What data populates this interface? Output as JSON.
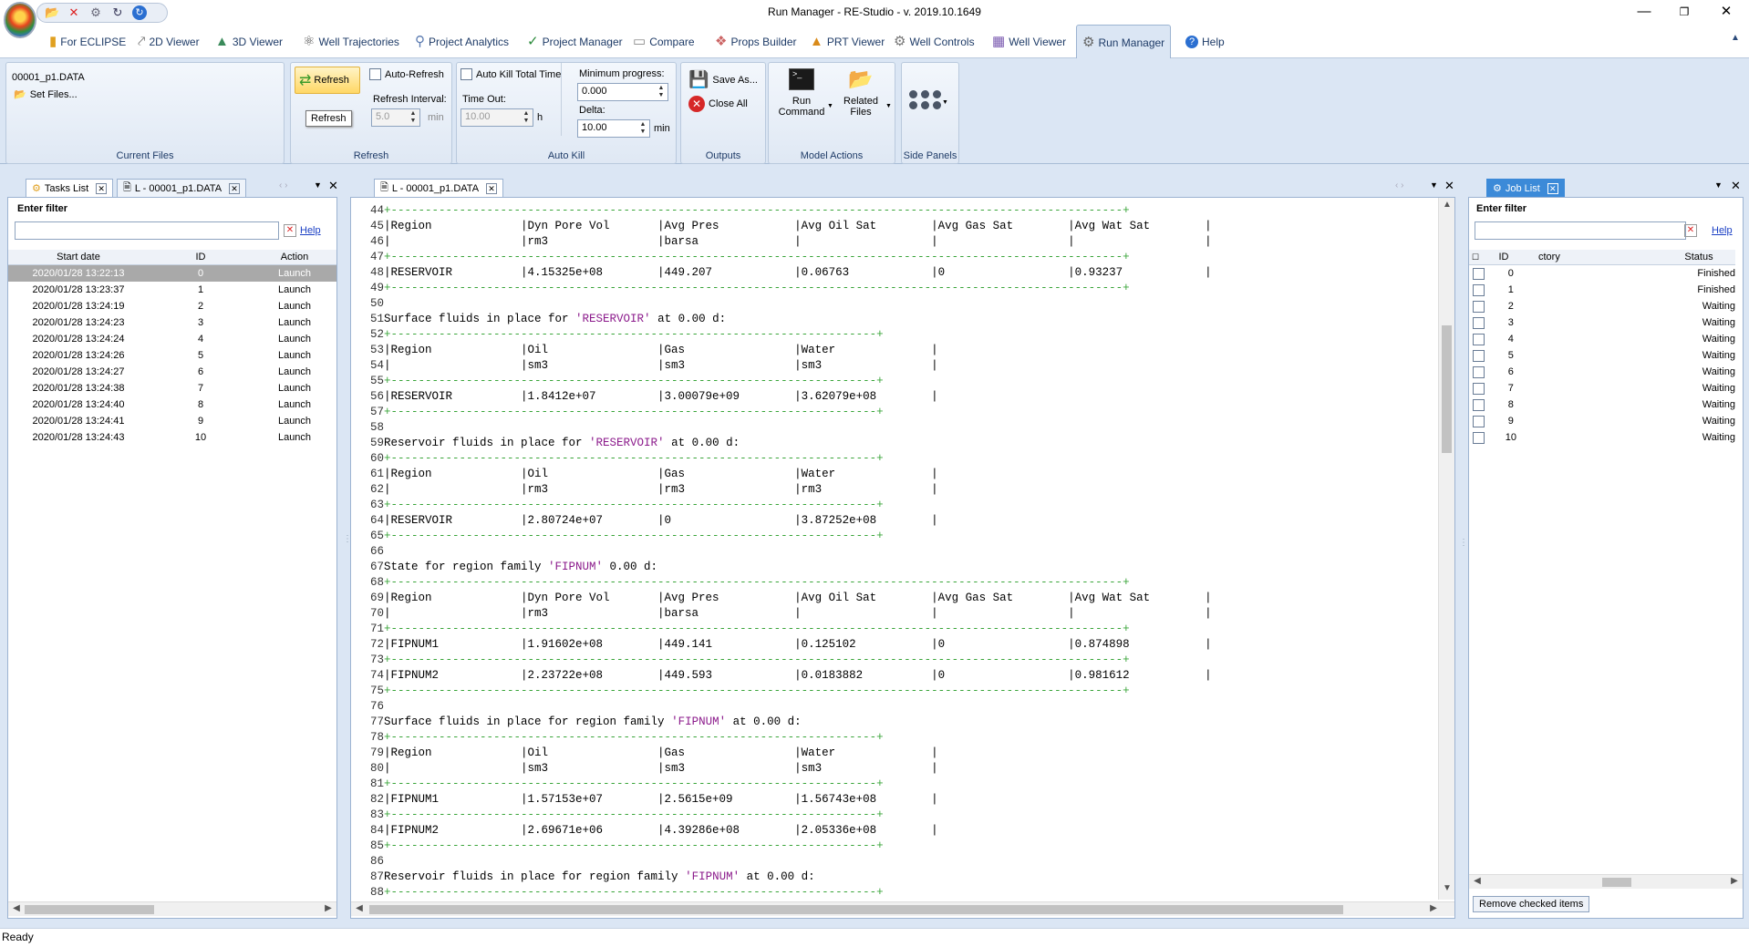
{
  "window": {
    "title": "Run Manager - RE-Studio - v. 2019.10.1649"
  },
  "ribbon_tabs": [
    {
      "label": "For ECLIPSE",
      "icon": "eclipse-icon"
    },
    {
      "label": "2D Viewer",
      "icon": "2d-viewer-icon"
    },
    {
      "label": "3D Viewer",
      "icon": "3d-viewer-icon"
    },
    {
      "label": "Well Trajectories",
      "icon": "well-trajectory-icon"
    },
    {
      "label": "Project Analytics",
      "icon": "analytics-icon"
    },
    {
      "label": "Project Manager",
      "icon": "project-manager-icon"
    },
    {
      "label": "Compare",
      "icon": "compare-icon"
    },
    {
      "label": "Props Builder",
      "icon": "props-builder-icon"
    },
    {
      "label": "PRT Viewer",
      "icon": "prt-viewer-icon"
    },
    {
      "label": "Well Controls",
      "icon": "well-controls-icon"
    },
    {
      "label": "Well Viewer",
      "icon": "well-viewer-icon"
    },
    {
      "label": "Run Manager",
      "icon": "run-manager-icon",
      "active": true
    },
    {
      "label": "Help",
      "icon": "help-icon"
    }
  ],
  "current_files": {
    "file": "00001_p1.DATA",
    "set_files": "Set Files...",
    "group_label": "Current Files"
  },
  "refresh": {
    "button": "Refresh",
    "tooltip": "Refresh",
    "auto_refresh": "Auto-Refresh",
    "interval_label": "Refresh Interval:",
    "interval_value": "5.0",
    "interval_unit": "min",
    "group_label": "Refresh"
  },
  "auto_kill": {
    "total_time": "Auto Kill Total Time",
    "timeout_label": "Time Out:",
    "timeout_value": "10.00",
    "timeout_unit": "h",
    "min_progress_label": "Minimum progress:",
    "min_progress_value": "0.000",
    "delta_label": "Delta:",
    "delta_value": "10.00",
    "delta_unit": "min",
    "group_label": "Auto Kill"
  },
  "outputs": {
    "save_as": "Save As...",
    "close_all": "Close All",
    "group_label": "Outputs"
  },
  "model_actions": {
    "run_command_1": "Run",
    "run_command_2": "Command",
    "related_files_1": "Related",
    "related_files_2": "Files",
    "group_label": "Model Actions"
  },
  "side_panels": {
    "group_label": "Side Panels"
  },
  "left_panel": {
    "tabs": [
      "Tasks List",
      "L - 00001_p1.DATA"
    ],
    "filter_label": "Enter filter",
    "help": "Help",
    "columns": [
      "Start date",
      "ID",
      "Action"
    ],
    "rows": [
      [
        "2020/01/28 13:22:13",
        "0",
        "Launch"
      ],
      [
        "2020/01/28 13:23:37",
        "1",
        "Launch"
      ],
      [
        "2020/01/28 13:24:19",
        "2",
        "Launch"
      ],
      [
        "2020/01/28 13:24:23",
        "3",
        "Launch"
      ],
      [
        "2020/01/28 13:24:24",
        "4",
        "Launch"
      ],
      [
        "2020/01/28 13:24:26",
        "5",
        "Launch"
      ],
      [
        "2020/01/28 13:24:27",
        "6",
        "Launch"
      ],
      [
        "2020/01/28 13:24:38",
        "7",
        "Launch"
      ],
      [
        "2020/01/28 13:24:40",
        "8",
        "Launch"
      ],
      [
        "2020/01/28 13:24:41",
        "9",
        "Launch"
      ],
      [
        "2020/01/28 13:24:43",
        "10",
        "Launch"
      ]
    ]
  },
  "editor": {
    "tab": "L - 00001_p1.DATA",
    "lines": [
      {
        "n": "44",
        "t": "+-----------------------------------------------------------------------------------------------------------+",
        "k": "dash"
      },
      {
        "n": "45",
        "t": "|Region             |Dyn Pore Vol       |Avg Pres           |Avg Oil Sat        |Avg Gas Sat        |Avg Wat Sat        |"
      },
      {
        "n": "46",
        "t": "|                   |rm3                |barsa              |                   |                   |                   |"
      },
      {
        "n": "47",
        "t": "+-----------------------------------------------------------------------------------------------------------+",
        "k": "dash"
      },
      {
        "n": "48",
        "t": "|RESERVOIR          |4.15325e+08        |449.207            |0.06763            |0                  |0.93237            |"
      },
      {
        "n": "49",
        "t": "+-----------------------------------------------------------------------------------------------------------+",
        "k": "dash"
      },
      {
        "n": "50",
        "t": ""
      },
      {
        "n": "51",
        "t": "Surface fluids in place for ",
        "s": "'RESERVOIR'",
        "a": " at 0.00 d:"
      },
      {
        "n": "52",
        "t": "+-----------------------------------------------------------------------+",
        "k": "dash"
      },
      {
        "n": "53",
        "t": "|Region             |Oil                |Gas                |Water              |"
      },
      {
        "n": "54",
        "t": "|                   |sm3                |sm3                |sm3                |"
      },
      {
        "n": "55",
        "t": "+-----------------------------------------------------------------------+",
        "k": "dash"
      },
      {
        "n": "56",
        "t": "|RESERVOIR          |1.8412e+07         |3.00079e+09        |3.62079e+08        |"
      },
      {
        "n": "57",
        "t": "+-----------------------------------------------------------------------+",
        "k": "dash"
      },
      {
        "n": "58",
        "t": ""
      },
      {
        "n": "59",
        "t": "Reservoir fluids in place for ",
        "s": "'RESERVOIR'",
        "a": " at 0.00 d:"
      },
      {
        "n": "60",
        "t": "+-----------------------------------------------------------------------+",
        "k": "dash"
      },
      {
        "n": "61",
        "t": "|Region             |Oil                |Gas                |Water              |"
      },
      {
        "n": "62",
        "t": "|                   |rm3                |rm3                |rm3                |"
      },
      {
        "n": "63",
        "t": "+-----------------------------------------------------------------------+",
        "k": "dash"
      },
      {
        "n": "64",
        "t": "|RESERVOIR          |2.80724e+07        |0                  |3.87252e+08        |"
      },
      {
        "n": "65",
        "t": "+-----------------------------------------------------------------------+",
        "k": "dash"
      },
      {
        "n": "66",
        "t": ""
      },
      {
        "n": "67",
        "t": "State for region family ",
        "s": "'FIPNUM'",
        "a": " 0.00 d:"
      },
      {
        "n": "68",
        "t": "+-----------------------------------------------------------------------------------------------------------+",
        "k": "dash"
      },
      {
        "n": "69",
        "t": "|Region             |Dyn Pore Vol       |Avg Pres           |Avg Oil Sat        |Avg Gas Sat        |Avg Wat Sat        |"
      },
      {
        "n": "70",
        "t": "|                   |rm3                |barsa              |                   |                   |                   |"
      },
      {
        "n": "71",
        "t": "+-----------------------------------------------------------------------------------------------------------+",
        "k": "dash"
      },
      {
        "n": "72",
        "t": "|FIPNUM1            |1.91602e+08        |449.141            |0.125102           |0                  |0.874898           |"
      },
      {
        "n": "73",
        "t": "+-----------------------------------------------------------------------------------------------------------+",
        "k": "dash"
      },
      {
        "n": "74",
        "t": "|FIPNUM2            |2.23722e+08        |449.593            |0.0183882          |0                  |0.981612           |"
      },
      {
        "n": "75",
        "t": "+-----------------------------------------------------------------------------------------------------------+",
        "k": "dash"
      },
      {
        "n": "76",
        "t": ""
      },
      {
        "n": "77",
        "t": "Surface fluids in place for region family ",
        "s": "'FIPNUM'",
        "a": " at 0.00 d:"
      },
      {
        "n": "78",
        "t": "+-----------------------------------------------------------------------+",
        "k": "dash"
      },
      {
        "n": "79",
        "t": "|Region             |Oil                |Gas                |Water              |"
      },
      {
        "n": "80",
        "t": "|                   |sm3                |sm3                |sm3                |"
      },
      {
        "n": "81",
        "t": "+-----------------------------------------------------------------------+",
        "k": "dash"
      },
      {
        "n": "82",
        "t": "|FIPNUM1            |1.57153e+07        |2.5615e+09         |1.56743e+08        |"
      },
      {
        "n": "83",
        "t": "+-----------------------------------------------------------------------+",
        "k": "dash"
      },
      {
        "n": "84",
        "t": "|FIPNUM2            |2.69671e+06        |4.39286e+08        |2.05336e+08        |"
      },
      {
        "n": "85",
        "t": "+-----------------------------------------------------------------------+",
        "k": "dash"
      },
      {
        "n": "86",
        "t": ""
      },
      {
        "n": "87",
        "t": "Reservoir fluids in place for region family ",
        "s": "'FIPNUM'",
        "a": " at 0.00 d:"
      },
      {
        "n": "88",
        "t": "+-----------------------------------------------------------------------+",
        "k": "dash"
      }
    ]
  },
  "right_panel": {
    "tab": "Job List",
    "filter_label": "Enter filter",
    "help": "Help",
    "columns": [
      "ID",
      "ctory",
      "Status"
    ],
    "rows": [
      [
        "0",
        "Finished"
      ],
      [
        "1",
        "Finished"
      ],
      [
        "2",
        "Waiting"
      ],
      [
        "3",
        "Waiting"
      ],
      [
        "4",
        "Waiting"
      ],
      [
        "5",
        "Waiting"
      ],
      [
        "6",
        "Waiting"
      ],
      [
        "7",
        "Waiting"
      ],
      [
        "8",
        "Waiting"
      ],
      [
        "9",
        "Waiting"
      ],
      [
        "10",
        "Waiting"
      ]
    ],
    "remove_button": "Remove checked items"
  },
  "status_bar": {
    "text": "Ready"
  }
}
